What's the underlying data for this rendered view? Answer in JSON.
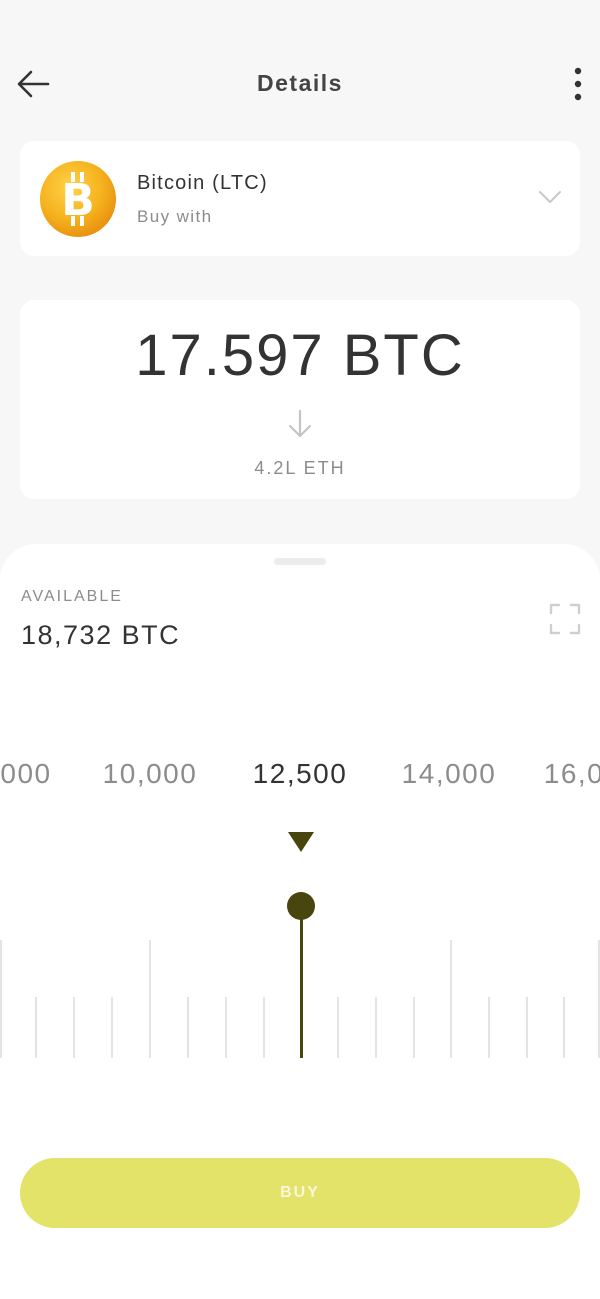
{
  "header": {
    "title": "Details",
    "back_icon": "arrow-left-icon",
    "more_icon": "more-vertical-icon"
  },
  "asset": {
    "name": "Bitcoin (LTC)",
    "subtitle": "Buy with",
    "logo_symbol": "B",
    "logo_icon": "bitcoin-logo-icon",
    "dropdown_icon": "chevron-down-icon"
  },
  "amount": {
    "value": "17.597 BTC",
    "conversion_icon": "arrow-down-icon",
    "converted": "4.2L ETH"
  },
  "balance": {
    "label": "AVAILABLE",
    "value": "18,732 BTC",
    "expand_icon": "expand-icon"
  },
  "scale": {
    "labels": [
      "000",
      "10,000",
      "12,500",
      "14,000",
      "16,0"
    ],
    "selected": "12,500",
    "pointer_icon": "triangle-down-icon"
  },
  "actions": {
    "buy_label": "BUY"
  },
  "colors": {
    "accent": "#e3e36a",
    "slider": "#48450e",
    "coin": "#f4a91c"
  }
}
